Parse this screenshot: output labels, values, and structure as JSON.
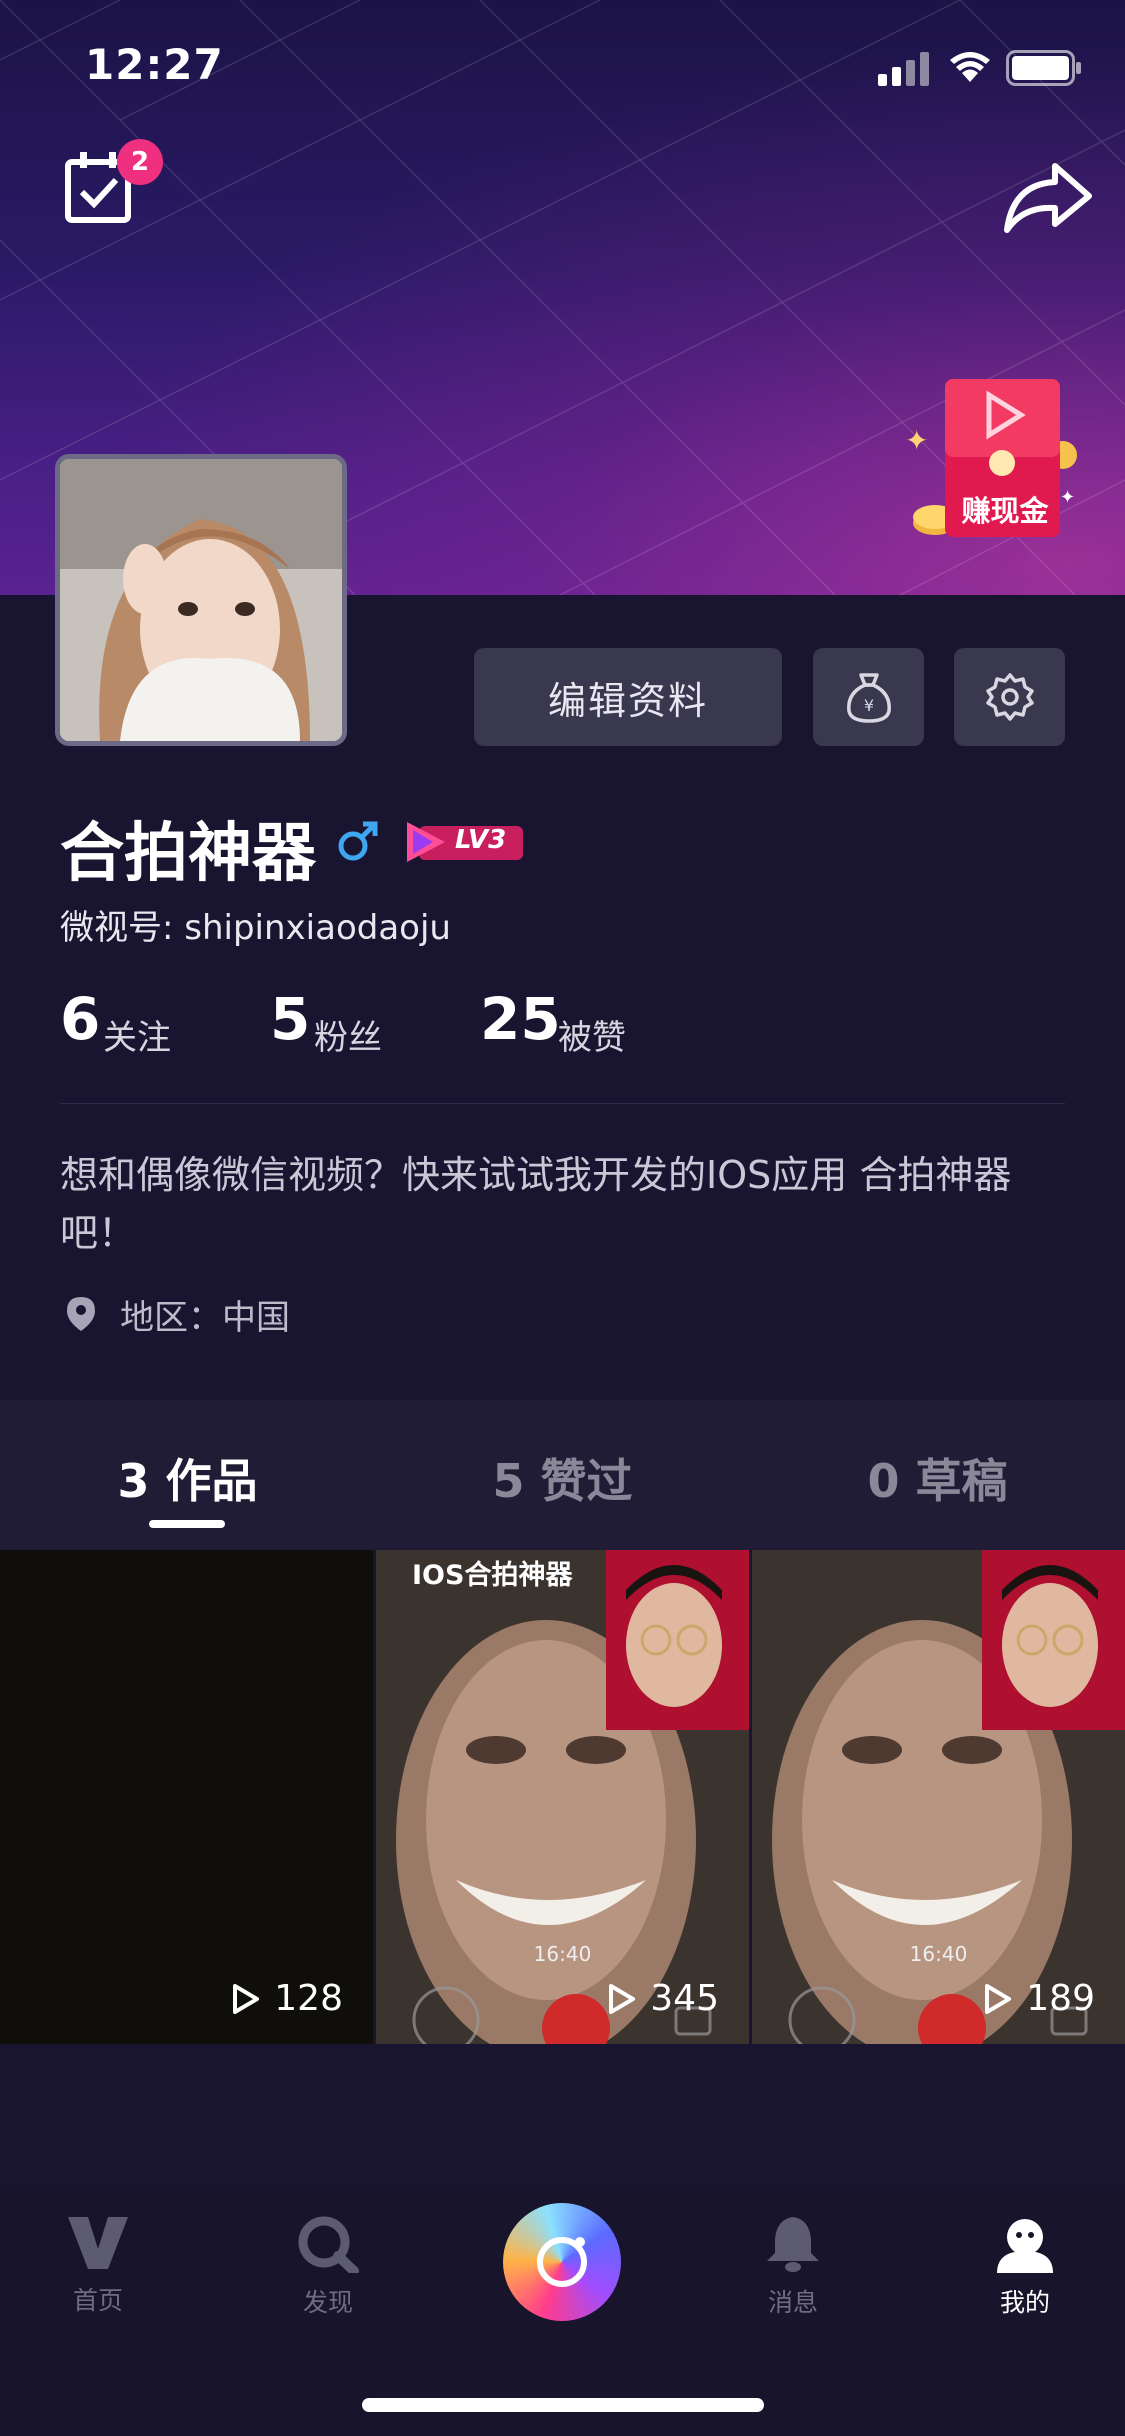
{
  "status_bar": {
    "time": "12:27"
  },
  "header": {
    "calendar_badge_count": "2",
    "earn_label": "赚现金"
  },
  "profile": {
    "edit_button_label": "编辑资料",
    "name": "合拍神器",
    "level": "LV3",
    "weishi_id": "微视号: shipinxiaodaoju",
    "stats": {
      "following_count": "6",
      "following_label": "关注",
      "fans_count": "5",
      "fans_label": "粉丝",
      "likes_count": "25",
      "likes_label": "被赞"
    },
    "bio": "想和偶像微信视频？快来试试我开发的IOS应用 合拍神器 吧！",
    "location": "地区：中国"
  },
  "tabs": [
    {
      "label": "3 作品",
      "active": true
    },
    {
      "label": "5 赞过",
      "active": false
    },
    {
      "label": "0 草稿",
      "active": false
    }
  ],
  "videos": [
    {
      "plays": "128",
      "caption": "",
      "time": ""
    },
    {
      "plays": "345",
      "caption": "IOS合拍神器",
      "time": "16:40"
    },
    {
      "plays": "189",
      "caption": "",
      "time": "16:40"
    }
  ],
  "bottom_nav": [
    {
      "label": "首页",
      "icon": "v-logo-icon"
    },
    {
      "label": "发现",
      "icon": "search-icon"
    },
    {
      "label": "",
      "icon": "camera-record-icon"
    },
    {
      "label": "消息",
      "icon": "bell-icon"
    },
    {
      "label": "我的",
      "icon": "user-icon"
    }
  ],
  "colors": {
    "badge": "#ef2f7f",
    "background": "#191530",
    "accent_pink": "#e8336e"
  }
}
